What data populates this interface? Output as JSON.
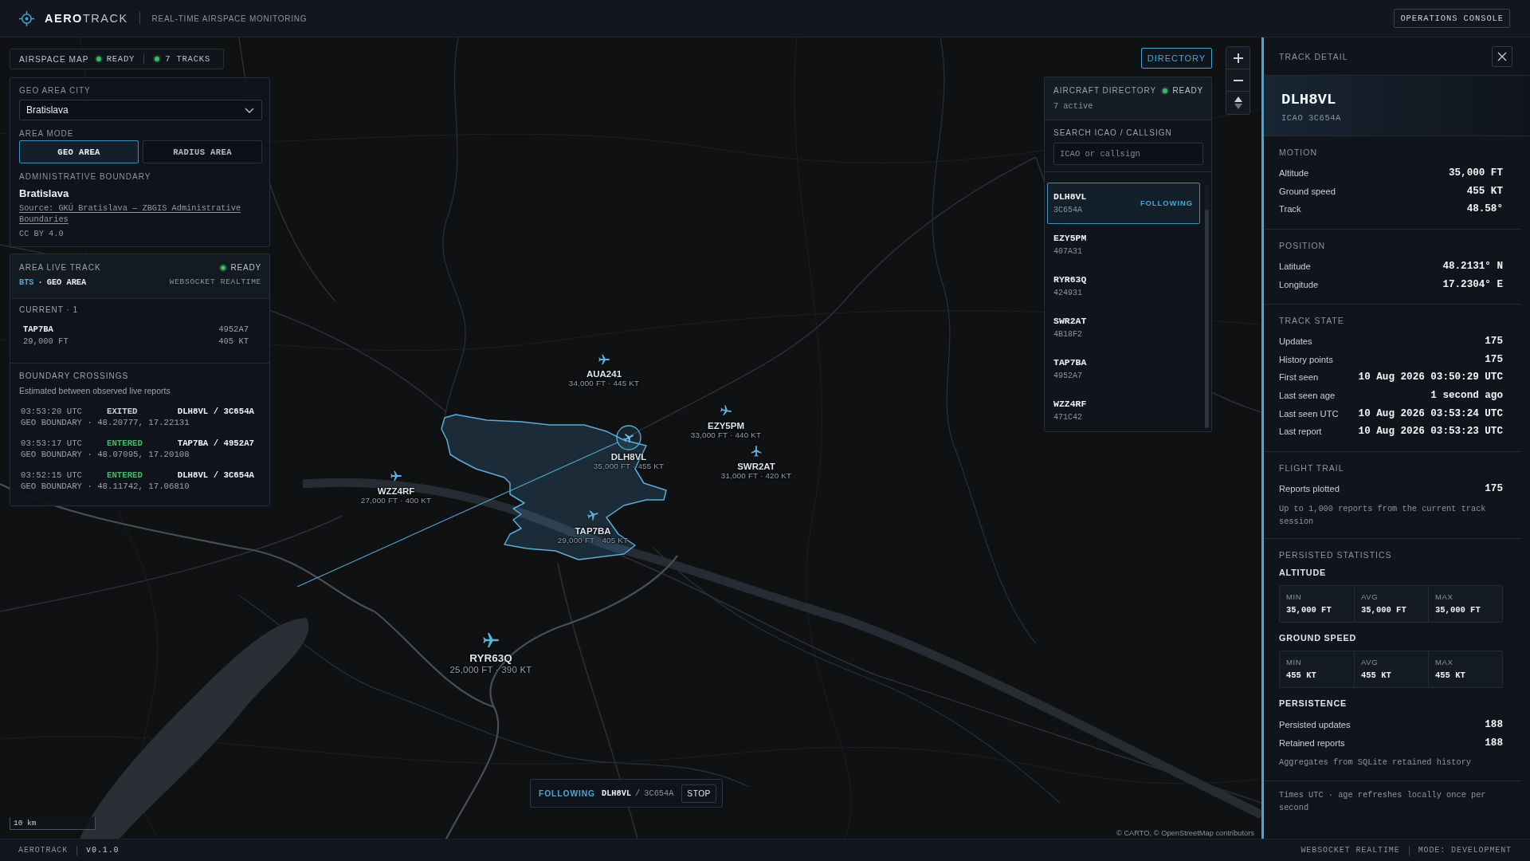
{
  "header": {
    "brand": "**AERO**TRACK",
    "subtitle": "REAL-TIME AIRSPACE MONITORING",
    "console_button": "OPERATIONS CONSOLE"
  },
  "map_status": {
    "title": "AIRSPACE MAP",
    "status": "READY",
    "tracks": "7 TRACKS"
  },
  "geo_area": {
    "city_label": "GEO AREA CITY",
    "city_value": "Bratislava",
    "mode_label": "AREA MODE",
    "modes": [
      {
        "label": "GEO AREA",
        "selected": true
      },
      {
        "label": "RADIUS AREA",
        "selected": false
      }
    ],
    "boundary_heading": "ADMINISTRATIVE BOUNDARY",
    "boundary_name": "Bratislava",
    "source": "Source: GKÚ Bratislava — ZBGIS Administrative Boundaries",
    "license": "CC BY 4.0"
  },
  "live_track": {
    "title": "AREA LIVE TRACK",
    "status": "READY",
    "source_tag": "BTS",
    "tag_separator": "·",
    "area_tag": "GEO AREA",
    "transport": "WEBSOCKET REALTIME",
    "current_label": "CURRENT · 1",
    "current": [
      {
        "callsign": "TAP7BA",
        "icao": "4952A7",
        "altitude": "29,000 FT",
        "speed": "405 KT"
      }
    ],
    "crossings_title": "BOUNDARY CROSSINGS",
    "crossings_note": "Estimated between observed live reports",
    "crossings": [
      {
        "time": "03:53:20 UTC",
        "kind": "exited",
        "event": "EXITED",
        "aircraft": "DLH8VL / 3C654A",
        "location": "GEO BOUNDARY · 48.20777, 17.22131"
      },
      {
        "time": "03:53:17 UTC",
        "kind": "entered",
        "event": "ENTERED",
        "aircraft": "TAP7BA / 4952A7",
        "location": "GEO BOUNDARY · 48.07095, 17.20108"
      },
      {
        "time": "03:52:15 UTC",
        "kind": "entered",
        "event": "ENTERED",
        "aircraft": "DLH8VL / 3C654A",
        "location": "GEO BOUNDARY · 48.11742, 17.06810"
      }
    ]
  },
  "directory_button": {
    "label": "DIRECTORY",
    "on": true
  },
  "aircraft_directory": {
    "title": "AIRCRAFT DIRECTORY",
    "status": "READY",
    "count": "7 active",
    "search_label": "SEARCH ICAO / CALLSIGN",
    "search": {
      "placeholder": "ICAO or callsign"
    },
    "items": [
      {
        "callsign": "DLH8VL",
        "icao": "3C654A",
        "selected": true,
        "badge": "FOLLOWING"
      },
      {
        "callsign": "EZY5PM",
        "icao": "407A31",
        "selected": false
      },
      {
        "callsign": "RYR63Q",
        "icao": "424931",
        "selected": false
      },
      {
        "callsign": "SWR2AT",
        "icao": "4B18F2",
        "selected": false
      },
      {
        "callsign": "TAP7BA",
        "icao": "4952A7",
        "selected": false
      },
      {
        "callsign": "WZZ4RF",
        "icao": "471C42",
        "selected": false
      }
    ]
  },
  "map_aircraft": [
    {
      "callsign": "AUA241",
      "detail": "34,000 FT · 445 KT",
      "followed": false
    },
    {
      "callsign": "EZY5PM",
      "detail": "33,000 FT · 440 KT",
      "followed": false
    },
    {
      "callsign": "DLH8VL",
      "detail": "35,000 FT · 455 KT",
      "followed": true
    },
    {
      "callsign": "SWR2AT",
      "detail": "31,000 FT · 420 KT",
      "followed": false
    },
    {
      "callsign": "WZZ4RF",
      "detail": "27,000 FT · 400 KT",
      "followed": false
    },
    {
      "callsign": "TAP7BA",
      "detail": "29,000 FT · 405 KT",
      "followed": false
    },
    {
      "callsign": "RYR63Q",
      "detail": "25,000 FT · 390 KT",
      "followed": false
    }
  ],
  "following_bar": {
    "label": "FOLLOWING",
    "callsign": "DLH8VL",
    "separator": "/",
    "icao": "3C654A",
    "stop_button": "STOP"
  },
  "map_scale": "10 km",
  "attribution": "© CARTO, © OpenStreetMap contributors",
  "track_detail": {
    "title": "TRACK DETAIL",
    "callsign": "DLH8VL",
    "icao": "ICAO 3C654A",
    "sections": [
      {
        "title": "MOTION",
        "rows": [
          {
            "label": "Altitude",
            "value": "35,000 FT"
          },
          {
            "label": "Ground speed",
            "value": "455 KT"
          },
          {
            "label": "Track",
            "value": "48.58°"
          }
        ]
      },
      {
        "title": "POSITION",
        "rows": [
          {
            "label": "Latitude",
            "value": "48.2131° N"
          },
          {
            "label": "Longitude",
            "value": "17.2304° E"
          }
        ]
      },
      {
        "title": "TRACK STATE",
        "rows": [
          {
            "label": "Updates",
            "value": "175"
          },
          {
            "label": "History points",
            "value": "175"
          },
          {
            "label": "First seen",
            "value": "10 Aug 2026 03:50:29 UTC"
          },
          {
            "label": "Last seen age",
            "value": "1 second ago"
          },
          {
            "label": "Last seen UTC",
            "value": "10 Aug 2026 03:53:24 UTC"
          },
          {
            "label": "Last report",
            "value": "10 Aug 2026 03:53:23 UTC"
          }
        ]
      },
      {
        "title": "FLIGHT TRAIL",
        "rows": [
          {
            "label": "Reports plotted",
            "value": "175"
          }
        ],
        "note": "Up to 1,000 reports from the current track session"
      }
    ],
    "persisted": {
      "title": "PERSISTED STATISTICS",
      "groups": [
        {
          "title": "ALTITUDE",
          "stats": [
            {
              "label": "MIN",
              "value": "35,000 FT"
            },
            {
              "label": "AVG",
              "value": "35,000 FT"
            },
            {
              "label": "MAX",
              "value": "35,000 FT"
            }
          ]
        },
        {
          "title": "GROUND SPEED",
          "stats": [
            {
              "label": "MIN",
              "value": "455 KT"
            },
            {
              "label": "AVG",
              "value": "455 KT"
            },
            {
              "label": "MAX",
              "value": "455 KT"
            }
          ]
        }
      ],
      "persistence": {
        "title": "PERSISTENCE",
        "rows": [
          {
            "label": "Persisted updates",
            "value": "188"
          },
          {
            "label": "Retained reports",
            "value": "188"
          }
        ],
        "note": "Aggregates from SQLite retained history"
      }
    },
    "footer_note": "Times UTC · age refreshes locally once per second"
  },
  "status_bar": {
    "app": "AEROTRACK",
    "version": "v0.1.0",
    "transport": "WEBSOCKET REALTIME",
    "mode": "MODE: DEVELOPMENT"
  }
}
